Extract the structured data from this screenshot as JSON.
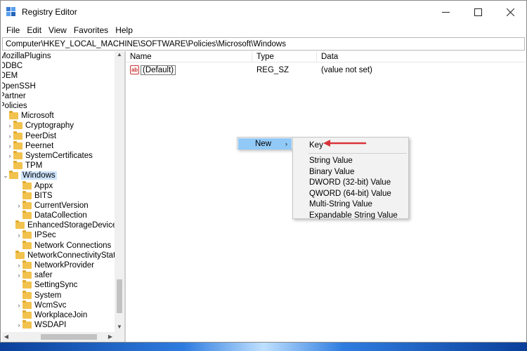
{
  "window": {
    "title": "Registry Editor"
  },
  "menu": [
    "File",
    "Edit",
    "View",
    "Favorites",
    "Help"
  ],
  "address": "Computer\\HKEY_LOCAL_MACHINE\\SOFTWARE\\Policies\\Microsoft\\Windows",
  "tree": [
    {
      "label": "MozillaPlugins",
      "indent": 0,
      "expander": "",
      "folder": false
    },
    {
      "label": "ODBC",
      "indent": 0,
      "expander": "",
      "folder": false
    },
    {
      "label": "OEM",
      "indent": 0,
      "expander": "",
      "folder": false
    },
    {
      "label": "OpenSSH",
      "indent": 0,
      "expander": "",
      "folder": false
    },
    {
      "label": "Partner",
      "indent": 0,
      "expander": "",
      "folder": false
    },
    {
      "label": "Policies",
      "indent": 0,
      "expander": "",
      "folder": false
    },
    {
      "label": "Microsoft",
      "indent": 1,
      "expander": "",
      "folder": true
    },
    {
      "label": "Cryptography",
      "indent": 2,
      "expander": ">",
      "folder": true
    },
    {
      "label": "PeerDist",
      "indent": 2,
      "expander": ">",
      "folder": true
    },
    {
      "label": "Peernet",
      "indent": 2,
      "expander": ">",
      "folder": true
    },
    {
      "label": "SystemCertificates",
      "indent": 2,
      "expander": ">",
      "folder": true
    },
    {
      "label": "TPM",
      "indent": 2,
      "expander": "",
      "folder": true
    },
    {
      "label": "Windows",
      "indent": 1,
      "expander": "v",
      "folder": true,
      "selected": true
    },
    {
      "label": "Appx",
      "indent": 3,
      "expander": "",
      "folder": true
    },
    {
      "label": "BITS",
      "indent": 3,
      "expander": "",
      "folder": true
    },
    {
      "label": "CurrentVersion",
      "indent": 3,
      "expander": ">",
      "folder": true
    },
    {
      "label": "DataCollection",
      "indent": 3,
      "expander": "",
      "folder": true
    },
    {
      "label": "EnhancedStorageDevices",
      "indent": 3,
      "expander": "",
      "folder": true
    },
    {
      "label": "IPSec",
      "indent": 3,
      "expander": ">",
      "folder": true
    },
    {
      "label": "Network Connections",
      "indent": 3,
      "expander": "",
      "folder": true
    },
    {
      "label": "NetworkConnectivityStatusIn",
      "indent": 3,
      "expander": "",
      "folder": true
    },
    {
      "label": "NetworkProvider",
      "indent": 3,
      "expander": ">",
      "folder": true
    },
    {
      "label": "safer",
      "indent": 3,
      "expander": ">",
      "folder": true
    },
    {
      "label": "SettingSync",
      "indent": 3,
      "expander": "",
      "folder": true
    },
    {
      "label": "System",
      "indent": 3,
      "expander": "",
      "folder": true
    },
    {
      "label": "WcmSvc",
      "indent": 3,
      "expander": ">",
      "folder": true
    },
    {
      "label": "WorkplaceJoin",
      "indent": 3,
      "expander": "",
      "folder": true
    },
    {
      "label": "WSDAPI",
      "indent": 3,
      "expander": ">",
      "folder": true
    }
  ],
  "list": {
    "headers": {
      "name": "Name",
      "type": "Type",
      "data": "Data"
    },
    "rows": [
      {
        "name": "(Default)",
        "type": "REG_SZ",
        "data": "(value not set)"
      }
    ]
  },
  "context_menu": {
    "new_label": "New",
    "submenu": [
      "Key",
      "String Value",
      "Binary Value",
      "DWORD (32-bit) Value",
      "QWORD (64-bit) Value",
      "Multi-String Value",
      "Expandable String Value"
    ]
  },
  "colors": {
    "selection": "#cde3fb",
    "menu_highlight": "#91c9f7",
    "annotation_arrow": "#d9343a",
    "folder": "#f2c24e"
  }
}
